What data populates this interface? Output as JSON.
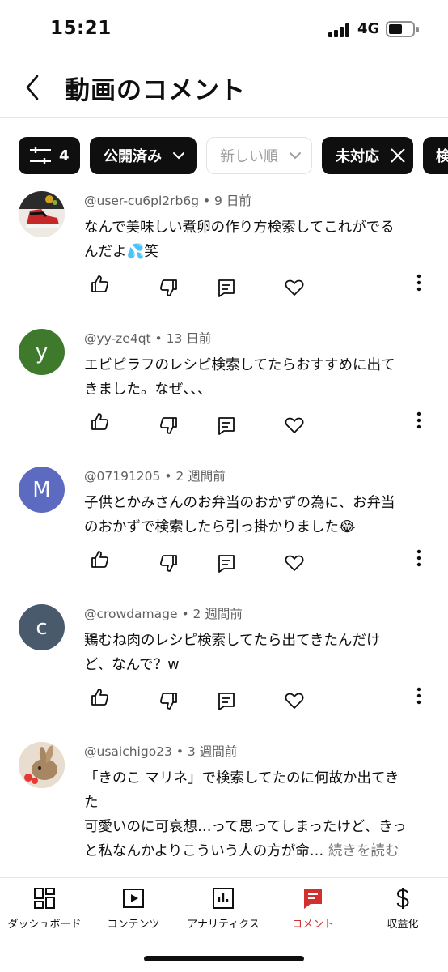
{
  "status_bar": {
    "time": "15:21",
    "network": "4G"
  },
  "header": {
    "title": "動画のコメント"
  },
  "filters": {
    "filter_count": "4",
    "published_label": "公開済み",
    "sort_label": "新しい順",
    "unanswered_label": "未対応",
    "search_partial": "検"
  },
  "comments": [
    {
      "author": "@user-cu6pl2rb6g",
      "time": "9 日前",
      "avatar_letter": "",
      "avatar_color": "#e8e2dc",
      "lines": [
        "なんで美味しい煮卵の作り方検索してこれがでる",
        "んだよ💦笑"
      ],
      "more": ""
    },
    {
      "author": "@yy-ze4qt",
      "time": "13 日前",
      "avatar_letter": "y",
      "avatar_color": "#3f7a2c",
      "lines": [
        "エビピラフのレシピ検索してたらおすすめに出て",
        "きました。なぜ、、、"
      ],
      "more": ""
    },
    {
      "author": "@07191205",
      "time": "2 週間前",
      "avatar_letter": "M",
      "avatar_color": "#5c6bc0",
      "lines": [
        "子供とかみさんのお弁当のおかずの為に、お弁当",
        "のおかずで検索したら引っ掛かりました😂"
      ],
      "more": ""
    },
    {
      "author": "@crowdamage",
      "time": "2 週間前",
      "avatar_letter": "c",
      "avatar_color": "#485a6b",
      "lines": [
        "鶏むね肉のレシピ検索してたら出てきたんだけ",
        "ど、なんで？w"
      ],
      "more": ""
    },
    {
      "author": "@usaichigo23",
      "time": "3 週間前",
      "avatar_letter": "",
      "avatar_color": "#d9c9b8",
      "lines": [
        "「きのこ マリネ」で検索してたのに何故か出てき",
        "た",
        "可愛いのに可哀想…って思ってしまったけど、きっ",
        "と私なんかよりこういう人の方が命…"
      ],
      "more": "続きを読む"
    }
  ],
  "bottom_nav": [
    {
      "label": "ダッシュボード",
      "icon": "dashboard-icon"
    },
    {
      "label": "コンテンツ",
      "icon": "content-icon"
    },
    {
      "label": "アナリティクス",
      "icon": "analytics-icon"
    },
    {
      "label": "コメント",
      "icon": "comment-icon",
      "active": true
    },
    {
      "label": "収益化",
      "icon": "dollar-icon"
    }
  ],
  "colors": {
    "accent": "#d32f2f",
    "chip_dark": "#0f0f0f"
  }
}
